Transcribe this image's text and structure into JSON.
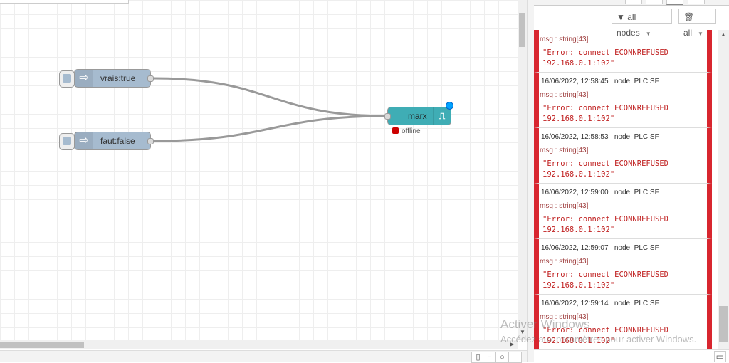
{
  "flow": {
    "nodes": [
      {
        "label": "vrais:true",
        "type": "inject"
      },
      {
        "label": "faut:false",
        "type": "inject"
      },
      {
        "label": "marx",
        "type": "modbus",
        "status": "offline"
      }
    ]
  },
  "sidebar": {
    "filter_label": "all nodes",
    "clear_label": "all",
    "entries": [
      {
        "header": "",
        "msg": "msg : string[43]",
        "error": "\"Error: connect ECONNREFUSED\n192.168.0.1:102\""
      },
      {
        "header": "16/06/2022, 12:58:45   node: PLC SF",
        "msg": "msg : string[43]",
        "error": "\"Error: connect ECONNREFUSED\n192.168.0.1:102\""
      },
      {
        "header": "16/06/2022, 12:58:53   node: PLC SF",
        "msg": "msg : string[43]",
        "error": "\"Error: connect ECONNREFUSED\n192.168.0.1:102\""
      },
      {
        "header": "16/06/2022, 12:59:00   node: PLC SF",
        "msg": "msg : string[43]",
        "error": "\"Error: connect ECONNREFUSED\n192.168.0.1:102\""
      },
      {
        "header": "16/06/2022, 12:59:07   node: PLC SF",
        "msg": "msg : string[43]",
        "error": "\"Error: connect ECONNREFUSED\n192.168.0.1:102\""
      },
      {
        "header": "16/06/2022, 12:59:14   node: PLC SF",
        "msg": "msg : string[43]",
        "error": "\"Error: connect ECONNREFUSED\n192.168.0.1:102\""
      }
    ]
  },
  "watermark": {
    "line1": "Activer Windows",
    "line2": "Accédez aux paramètres pour activer Windows."
  },
  "colors": {
    "error": "#d8262f",
    "inject": "#a6bbcf",
    "modbus": "#3fadb5"
  }
}
